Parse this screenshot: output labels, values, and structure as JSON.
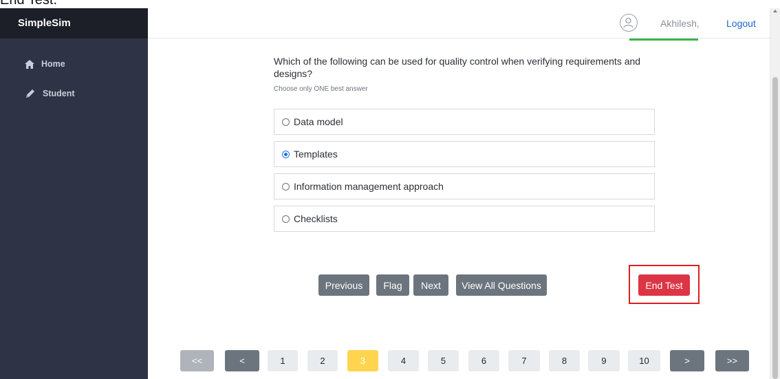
{
  "caption": "End Test.",
  "app": {
    "title": "SimpleSim"
  },
  "sidebar": {
    "items": [
      {
        "label": "Home",
        "icon": "home-icon"
      },
      {
        "label": "Student",
        "icon": "pencil-icon"
      }
    ]
  },
  "header": {
    "user_name": "Akhilesh,",
    "logout_label": "Logout"
  },
  "question": {
    "text": "Which of the following can be used for quality control when verifying requirements and designs?",
    "hint": "Choose only ONE best answer",
    "options": [
      {
        "label": "Data model",
        "selected": false
      },
      {
        "label": "Templates",
        "selected": true
      },
      {
        "label": "Information management approach",
        "selected": false
      },
      {
        "label": "Checklists",
        "selected": false
      }
    ]
  },
  "actions": {
    "previous": "Previous",
    "flag": "Flag",
    "next": "Next",
    "view_all": "View All Questions",
    "end_test": "End Test"
  },
  "pagination": {
    "first": "<<",
    "prev": "<",
    "pages": [
      "1",
      "2",
      "3",
      "4",
      "5",
      "6",
      "7",
      "8",
      "9",
      "10"
    ],
    "current": "3",
    "next": ">",
    "last": ">>"
  },
  "colors": {
    "sidebar": "#2e3445",
    "sidebar_header": "#1c1f27",
    "button_gray": "#6c757d",
    "danger": "#dc3545",
    "highlight_outline": "#dc1f1f",
    "current_page": "#ffd54f",
    "link": "#1a66d2"
  }
}
